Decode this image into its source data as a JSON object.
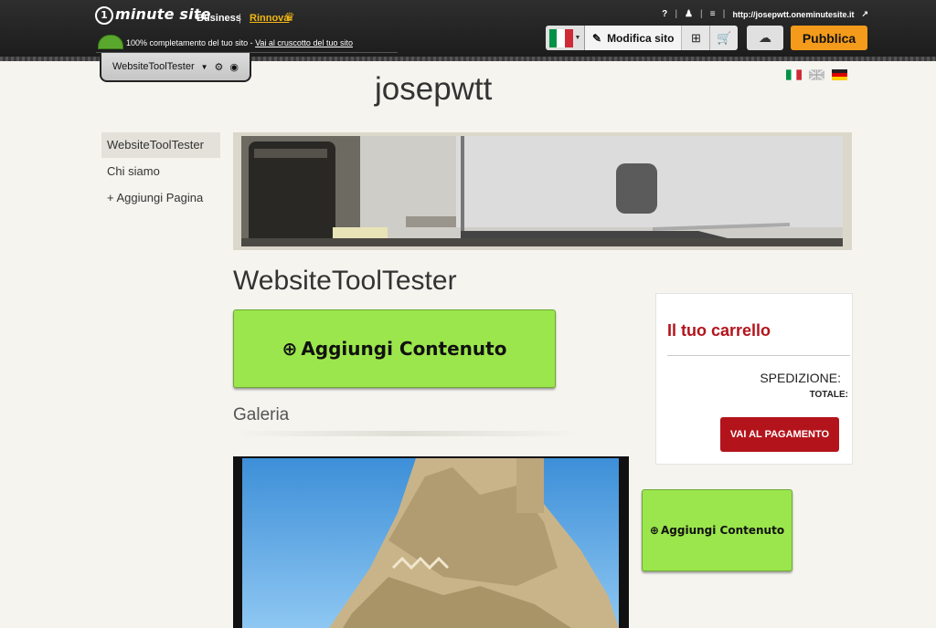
{
  "topbar": {
    "logo_one": "1",
    "logo": "minute site",
    "plan": "Business",
    "separator": "|",
    "renew": "Rinnova",
    "progress_text": "100% completamento del tuo sito - ",
    "progress_link": "Vai al cruscotto del tuo sito",
    "progress_percent": 100,
    "site_url": "http://josepwtt.oneminutesite.it",
    "edit_label": "Modifica sito",
    "publish_label": "Pubblica"
  },
  "tab": {
    "label": "WebsiteToolTester"
  },
  "site": {
    "title": "josepwtt"
  },
  "sidebar": {
    "items": [
      {
        "label": "WebsiteToolTester"
      },
      {
        "label": "Chi siamo"
      },
      {
        "label": "+ Aggiungi Pagina"
      }
    ]
  },
  "main": {
    "heading": "WebsiteToolTester",
    "add_content_label": "Aggiungi Contenuto",
    "gallery_title": "Galeria"
  },
  "cart": {
    "title": "Il tuo carrello",
    "shipping": "SPEDIZIONE:",
    "total": "TOTALE:",
    "pay_label": "VAI AL PAGAMENTO"
  },
  "side_widget": {
    "add_content_label": "Aggiungi Contenuto"
  },
  "colors": {
    "accent_green": "#9be64c",
    "publish_orange": "#f49b1b",
    "cart_red": "#b3141c",
    "renew_gold": "#f1b814"
  },
  "icons": [
    "help-icon",
    "user-icon",
    "menu-icon",
    "external-link-icon",
    "pencil-icon",
    "layout-icon",
    "cart-icon",
    "cloud-icon",
    "crown-icon",
    "gear-icon",
    "eye-icon",
    "plus-circle-icon"
  ]
}
